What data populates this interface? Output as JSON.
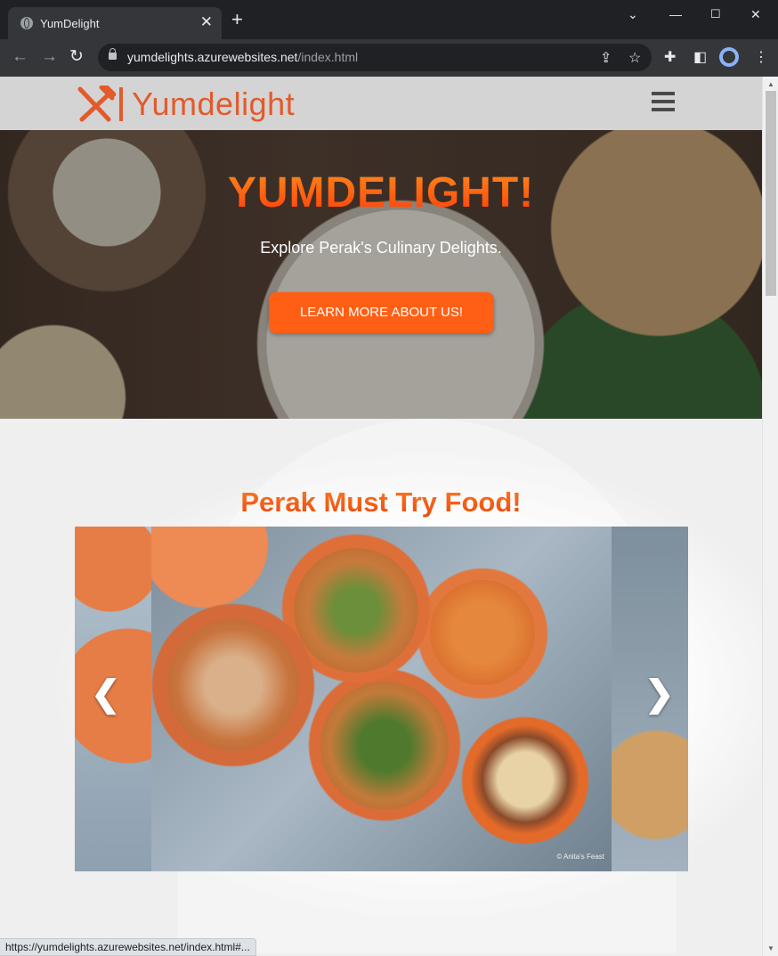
{
  "browser": {
    "tab_title": "YumDelight",
    "close_glyph": "✕",
    "new_tab_glyph": "+",
    "url_domain": "yumdelights.azurewebsites.net",
    "url_path": "/index.html",
    "status_url": "https://yumdelights.azurewebsites.net/index.html#...",
    "icons": [
      "globe-icon",
      "back-icon",
      "forward-icon",
      "reload-icon",
      "lock-icon",
      "share-icon",
      "star-icon",
      "extensions-icon",
      "side-panel-icon",
      "profile-icon",
      "menu-icon",
      "minimize-icon",
      "maximize-icon",
      "close-icon"
    ]
  },
  "site": {
    "logo_text": "Yumdelight",
    "hero": {
      "title": "YUMDELIGHT!",
      "subtitle": "Explore Perak's Culinary Delights.",
      "button_label": "LEARN MORE ABOUT US!"
    },
    "section_title": "Perak Must Try Food!",
    "carousel": {
      "credit": "© Anita's Feast",
      "prev_glyph": "❮",
      "next_glyph": "❯"
    }
  },
  "colors": {
    "accent": "#ff5f15",
    "logo": "#e35a2b",
    "header_bg": "#d4d4d4"
  }
}
